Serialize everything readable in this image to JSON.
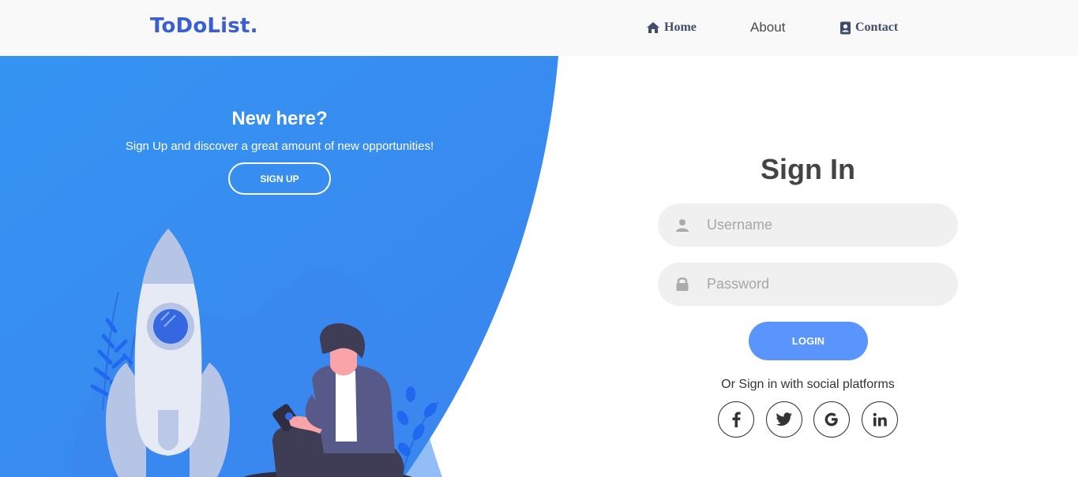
{
  "navbar": {
    "brand": "ToDoList.",
    "items": [
      {
        "label": "Home",
        "icon": "home-icon"
      },
      {
        "label": "About"
      },
      {
        "label": "Contact",
        "icon": "contact-icon"
      }
    ]
  },
  "panel": {
    "title": "New here?",
    "subtitle": "Sign Up and discover a great amount of new opportunities!",
    "signup_label": "SIGN UP"
  },
  "signin": {
    "title": "Sign In",
    "username_placeholder": "Username",
    "password_placeholder": "Password",
    "login_label": "LOGIN",
    "social_text": "Or Sign in with social platforms",
    "social": [
      "facebook-icon",
      "twitter-icon",
      "google-icon",
      "linkedin-icon"
    ]
  },
  "colors": {
    "accent": "#5995fd",
    "panel_blue": "#3a8ef0",
    "brand": "#3a5fd0"
  }
}
